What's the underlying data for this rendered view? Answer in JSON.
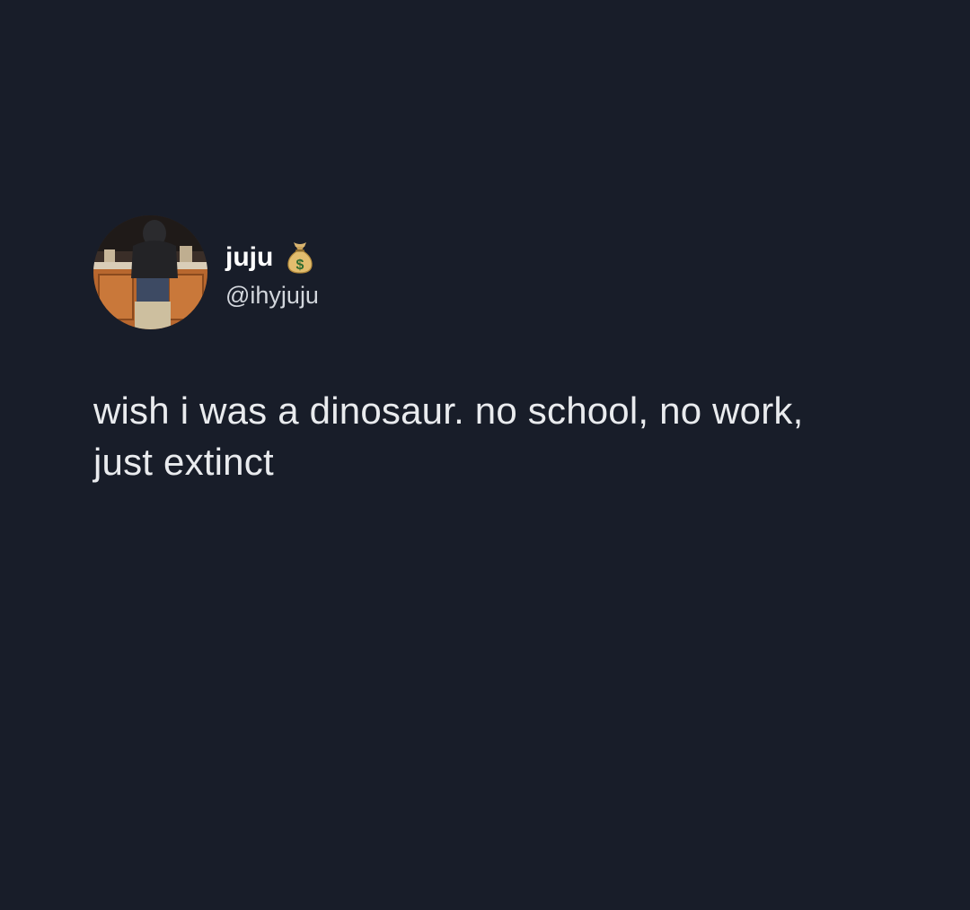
{
  "tweet": {
    "author": {
      "display_name": "juju",
      "handle": "@ihyjuju",
      "badge_icon": "money-bag-icon"
    },
    "text": "wish i was a dinosaur. no school, no work, just extinct"
  },
  "colors": {
    "background": "#181d29",
    "text_primary": "#ffffff",
    "text_secondary": "#d2d6dc"
  }
}
